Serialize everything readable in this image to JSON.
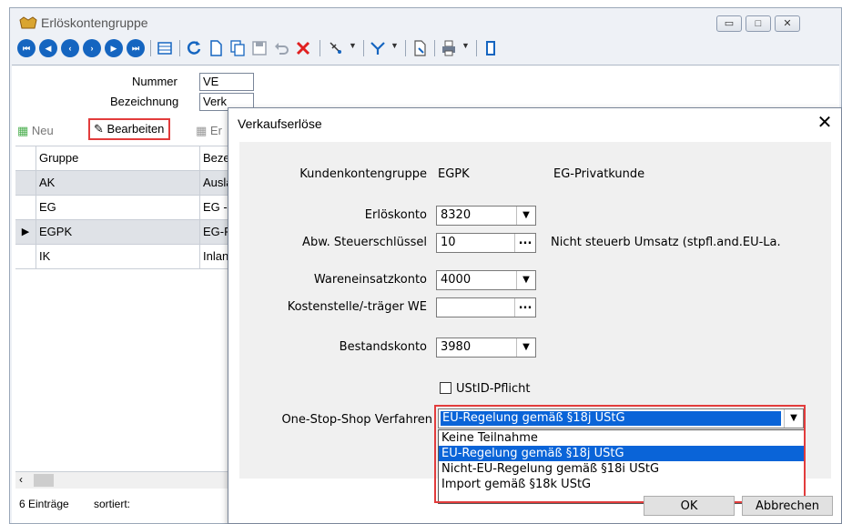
{
  "window": {
    "title": "Erlöskontengruppe"
  },
  "header": {
    "nummer_label": "Nummer",
    "nummer_value": "VE",
    "bezeichnung_label": "Bezeichnung",
    "bezeichnung_value": "Verk"
  },
  "list_toolbar": {
    "neu": "Neu",
    "bearbeiten": "Bearbeiten",
    "entfernen": "Er"
  },
  "grid": {
    "columns": [
      "Gruppe",
      "Beze"
    ],
    "rows": [
      {
        "gruppe": "AK",
        "bez": "Ausla"
      },
      {
        "gruppe": "EG",
        "bez": "EG -"
      },
      {
        "gruppe": "EGPK",
        "bez": "EG-F"
      },
      {
        "gruppe": "IK",
        "bez": "Inlan"
      }
    ]
  },
  "status": {
    "count": "6 Einträge",
    "sort": "sortiert:"
  },
  "dialog": {
    "title": "Verkaufserlöse",
    "close": "✕",
    "kundenkontengruppe": {
      "label": "Kundenkontengruppe",
      "code": "EGPK",
      "name": "EG-Privatkunde"
    },
    "erloeskonto": {
      "label": "Erlöskonto",
      "value": "8320"
    },
    "steuerschluessel": {
      "label": "Abw. Steuerschlüssel",
      "value": "10",
      "desc": "Nicht steuerb Umsatz (stpfl.and.EU-La."
    },
    "wareneinsatzkonto": {
      "label": "Wareneinsatzkonto",
      "value": "4000"
    },
    "kostenstelle": {
      "label": "Kostenstelle/-träger WE",
      "value": ""
    },
    "bestandskonto": {
      "label": "Bestandskonto",
      "value": "3980"
    },
    "ustid": {
      "label": "UStID-Pflicht",
      "checked": false
    },
    "oss": {
      "label": "One-Stop-Shop Verfahren",
      "selected": "EU-Regelung gemäß §18j UStG",
      "options": [
        "Keine Teilnahme",
        "EU-Regelung gemäß §18j UStG",
        "Nicht-EU-Regelung gemäß §18i UStG",
        "Import gemäß §18k UStG"
      ]
    },
    "ok": "OK",
    "cancel": "Abbrechen"
  },
  "colors": {
    "accent": "#0a64d8",
    "highlight": "#e23c3c",
    "nav": "#1565c0"
  }
}
